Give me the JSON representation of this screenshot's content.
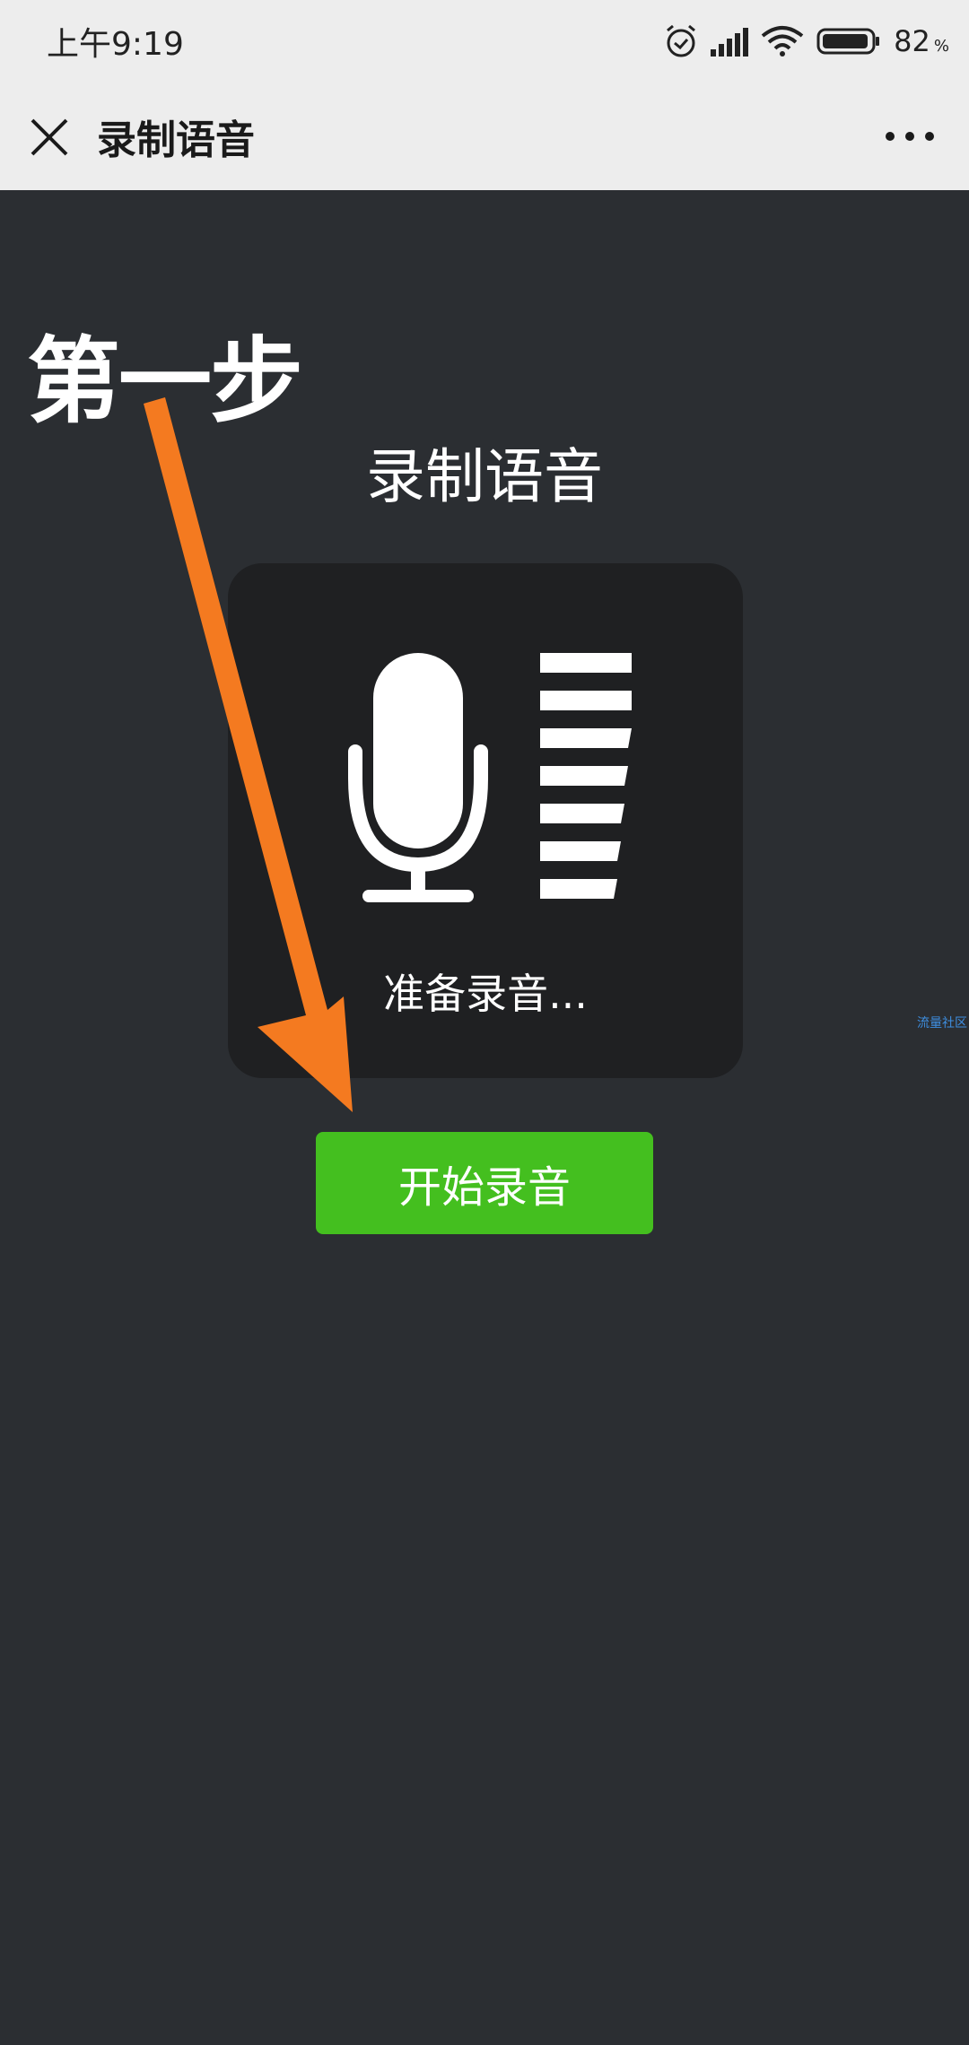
{
  "status_bar": {
    "time": "上午9:19",
    "battery": "82",
    "battery_unit": "%",
    "icons": [
      "alarm-icon",
      "signal-icon",
      "wifi-icon",
      "battery-icon"
    ]
  },
  "nav": {
    "title": "录制语音",
    "close_icon": "close-icon",
    "more_icon": "more-icon"
  },
  "annotation": {
    "step_label": "第一步",
    "arrow_color": "#f47a20"
  },
  "main": {
    "title": "录制语音",
    "status_text": "准备录音...",
    "start_button_label": "开始录音",
    "mic_icon": "microphone-icon"
  },
  "watermark": "流量社区",
  "colors": {
    "background": "#2b2e32",
    "card": "#1f2022",
    "button": "#44bf1f",
    "header": "#ededed"
  }
}
